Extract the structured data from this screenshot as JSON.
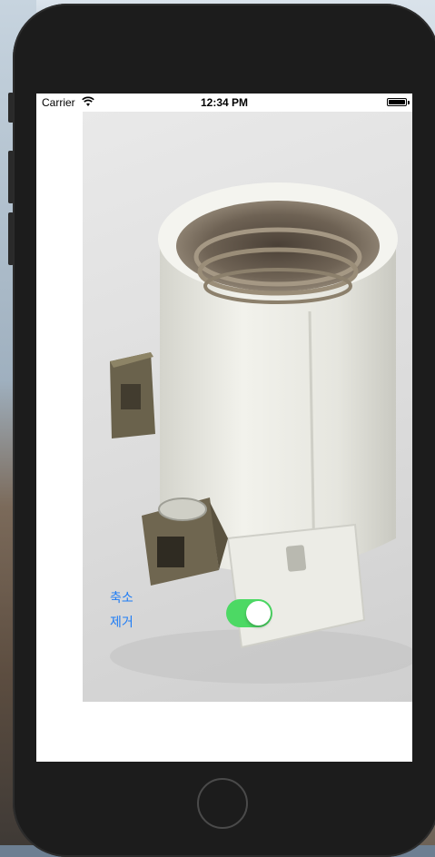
{
  "status_bar": {
    "carrier": "Carrier",
    "time": "12:34 PM",
    "wifi_icon": "wifi-icon",
    "battery_icon": "battery-icon"
  },
  "photo": {
    "subject": "ceramic-lamp-socket-image"
  },
  "controls": {
    "zoom_label": "축소",
    "remove_label": "제거",
    "toggle_on": true,
    "toggle_color": "#4cd964",
    "link_color": "#1e7cf5"
  }
}
